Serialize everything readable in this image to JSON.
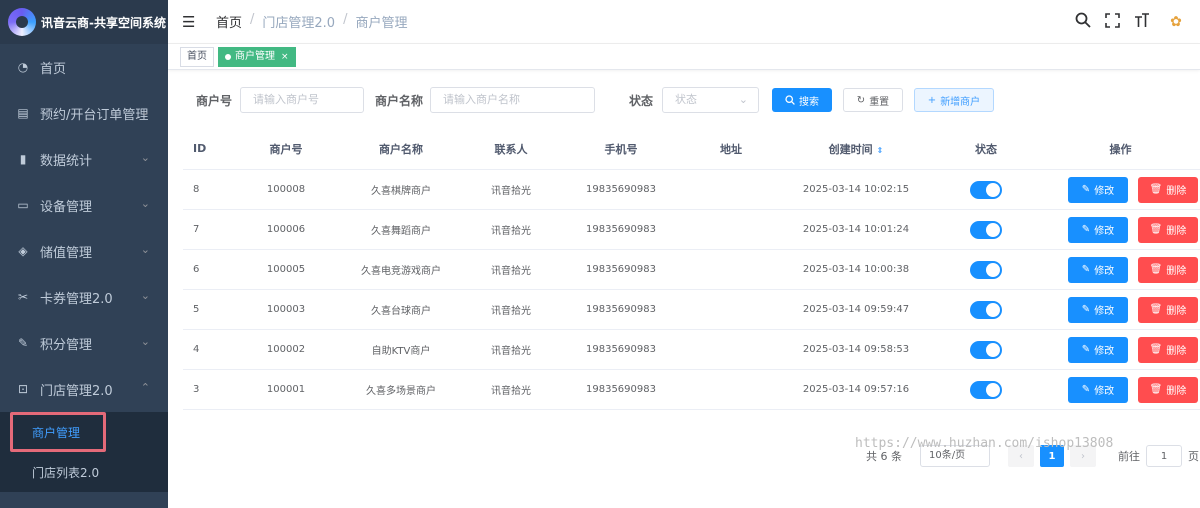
{
  "app": {
    "title": "讯音云商-共享空间系统"
  },
  "sidebar": {
    "items": [
      {
        "label": "首页",
        "icon": "dashboard-icon",
        "chevron": ""
      },
      {
        "label": "预约/开台订单管理",
        "icon": "order-icon",
        "chevron": "⌄"
      },
      {
        "label": "数据统计",
        "icon": "bar-chart-icon",
        "chevron": "⌄"
      },
      {
        "label": "设备管理",
        "icon": "device-icon",
        "chevron": "⌄"
      },
      {
        "label": "储值管理",
        "icon": "wallet-icon",
        "chevron": "⌄"
      },
      {
        "label": "卡券管理2.0",
        "icon": "coupon-icon",
        "chevron": "⌄"
      },
      {
        "label": "积分管理",
        "icon": "edit-icon",
        "chevron": "⌄"
      },
      {
        "label": "门店管理2.0",
        "icon": "store-icon",
        "chevron": "⌃"
      }
    ],
    "submenu": [
      {
        "label": "商户管理",
        "active": true
      },
      {
        "label": "门店列表2.0",
        "active": false
      }
    ]
  },
  "header": {
    "breadcrumb": [
      "首页",
      "门店管理2.0",
      "商户管理"
    ],
    "separator": "/",
    "tools": [
      "search-icon",
      "fullscreen-icon",
      "font-size-icon",
      "avatar"
    ]
  },
  "tags": {
    "home": "首页",
    "active": "商户管理",
    "close": "×"
  },
  "filters": {
    "merchant_no_label": "商户号",
    "merchant_no_placeholder": "请输入商户号",
    "merchant_name_label": "商户名称",
    "merchant_name_placeholder": "请输入商户名称",
    "status_label": "状态",
    "status_placeholder": "状态",
    "search_button": "搜索",
    "reset_button": "重置",
    "add_button": "新增商户"
  },
  "table": {
    "columns": [
      "ID",
      "商户号",
      "商户名称",
      "联系人",
      "手机号",
      "地址",
      "创建时间",
      "状态",
      "操作"
    ],
    "rows": [
      {
        "id": "8",
        "no": "100008",
        "name": "久喜棋牌商户",
        "contact": "讯音拾光",
        "phone": "19835690983",
        "address": "",
        "created": "2025-03-14 10:02:15",
        "enabled": true
      },
      {
        "id": "7",
        "no": "100006",
        "name": "久喜舞蹈商户",
        "contact": "讯音拾光",
        "phone": "19835690983",
        "address": "",
        "created": "2025-03-14 10:01:24",
        "enabled": true
      },
      {
        "id": "6",
        "no": "100005",
        "name": "久喜电竞游戏商户",
        "contact": "讯音拾光",
        "phone": "19835690983",
        "address": "",
        "created": "2025-03-14 10:00:38",
        "enabled": true
      },
      {
        "id": "5",
        "no": "100003",
        "name": "久喜台球商户",
        "contact": "讯音拾光",
        "phone": "19835690983",
        "address": "",
        "created": "2025-03-14 09:59:47",
        "enabled": true
      },
      {
        "id": "4",
        "no": "100002",
        "name": "自助KTV商户",
        "contact": "讯音拾光",
        "phone": "19835690983",
        "address": "",
        "created": "2025-03-14 09:58:53",
        "enabled": true
      },
      {
        "id": "3",
        "no": "100001",
        "name": "久喜多场景商户",
        "contact": "讯音拾光",
        "phone": "19835690983",
        "address": "",
        "created": "2025-03-14 09:57:16",
        "enabled": true
      }
    ],
    "edit_label": "修改",
    "delete_label": "删除"
  },
  "pagination": {
    "total": "共 6 条",
    "page_size": "10条/页",
    "prev": "‹",
    "current": "1",
    "next": "›",
    "goto_label": "前往",
    "goto_value": "1",
    "goto_suffix": "页"
  },
  "watermark": "https://www.huzhan.com/ishop13808",
  "colors": {
    "primary": "#1890ff",
    "danger": "#ff4d4f",
    "sidebar": "#304156",
    "tag_active": "#42b983"
  }
}
